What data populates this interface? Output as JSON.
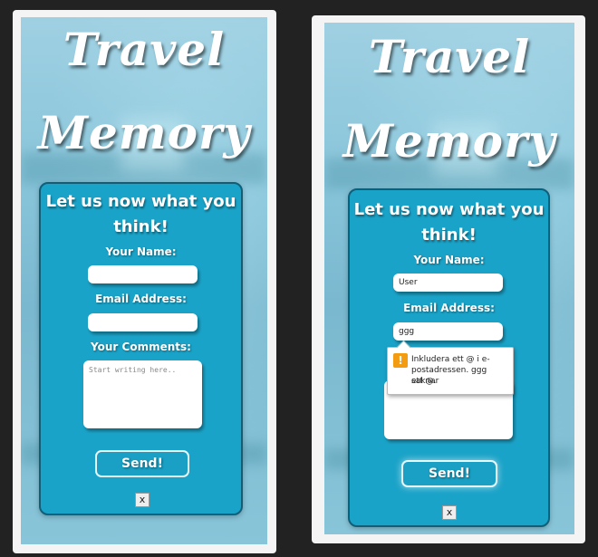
{
  "left": {
    "logo_line1": "Travel",
    "logo_line2": "Memory",
    "form": {
      "title_line1": "Let us now what you",
      "title_line2": "think!",
      "name_label": "Your Name:",
      "name_value": "",
      "email_label": "Email Address:",
      "email_value": "",
      "comments_label": "Your Comments:",
      "comments_placeholder": "Start writing here..",
      "send_label": "Send!",
      "close_label": "x"
    }
  },
  "right": {
    "logo_line1": "Travel",
    "logo_line2": "Memory",
    "form": {
      "title_line1": "Let us now what you",
      "title_line2": "think!",
      "name_label": "Your Name:",
      "name_value": "User",
      "email_label": "Email Address:",
      "email_value": "ggg",
      "send_label": "Send!",
      "close_label": "x"
    },
    "validation_tooltip": {
      "icon": "warning-icon",
      "text_line1": "Inkludera ett @ i e-",
      "text_line2": "postadressen. ggg saknar",
      "text_line3": "ett @."
    }
  },
  "colors": {
    "card_bg": "#1aa3c8",
    "card_border": "#0f5f78",
    "page_bg": "#222222",
    "warning": "#f39c12"
  }
}
